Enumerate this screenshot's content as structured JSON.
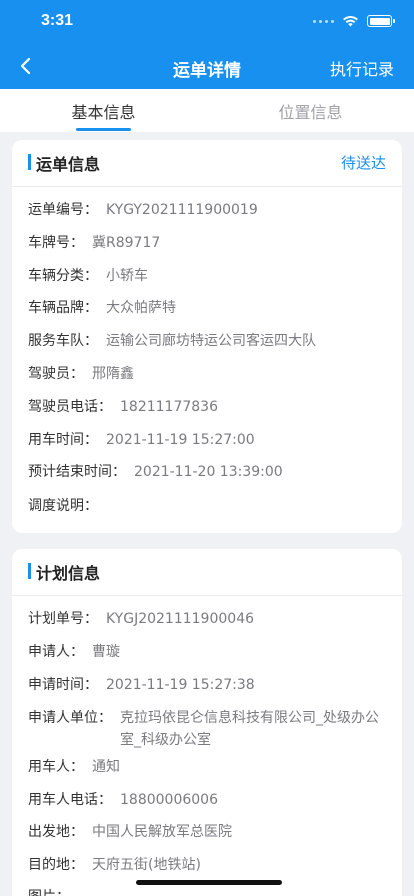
{
  "status": {
    "time": "3:31"
  },
  "nav": {
    "title": "运单详情",
    "right": "执行记录"
  },
  "tabs": [
    "基本信息",
    "位置信息"
  ],
  "waybill": {
    "title": "运单信息",
    "status": "待送达",
    "rows": [
      {
        "label": "运单编号：",
        "value": "KYGY2021111900019"
      },
      {
        "label": "车牌号：",
        "value": "冀R89717"
      },
      {
        "label": "车辆分类：",
        "value": "小轿车"
      },
      {
        "label": "车辆品牌：",
        "value": "大众帕萨特"
      },
      {
        "label": "服务车队：",
        "value": "运输公司廊坊特运公司客运四大队"
      },
      {
        "label": "驾驶员：",
        "value": "邢隋鑫"
      },
      {
        "label": "驾驶员电话：",
        "value": "18211177836"
      },
      {
        "label": "用车时间：",
        "value": "2021-11-19 15:27:00"
      },
      {
        "label": "预计结束时间：",
        "value": "2021-11-20 13:39:00"
      },
      {
        "label": "调度说明：",
        "value": ""
      }
    ]
  },
  "plan": {
    "title": "计划信息",
    "rows": [
      {
        "label": "计划单号：",
        "value": "KYGJ2021111900046"
      },
      {
        "label": "申请人：",
        "value": "曹璇"
      },
      {
        "label": "申请时间：",
        "value": "2021-11-19 15:27:38"
      },
      {
        "label": "申请人单位：",
        "value": "克拉玛依昆仑信息科技有限公司_处级办公室_科级办公室"
      },
      {
        "label": "用车人：",
        "value": "通知"
      },
      {
        "label": "用车人电话：",
        "value": "18800006006"
      },
      {
        "label": "出发地：",
        "value": "中国人民解放军总医院"
      },
      {
        "label": "目的地：",
        "value": "天府五街(地铁站)"
      },
      {
        "label": "图片：",
        "value": ""
      }
    ]
  }
}
